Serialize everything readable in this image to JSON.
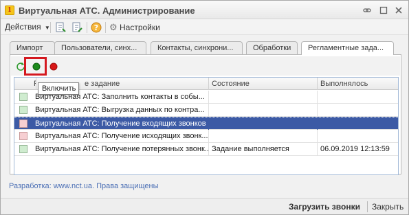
{
  "window": {
    "title": "Виртуальная АТС. Администрирование"
  },
  "toolbar": {
    "actions_label": "Действия",
    "settings_label": "Настройки"
  },
  "tabs": [
    {
      "label": "Импорт"
    },
    {
      "label": "Пользователи, синх..."
    },
    {
      "label": "Контакты, синхрони..."
    },
    {
      "label": "Обработки"
    },
    {
      "label": "Регламентные зада..."
    }
  ],
  "active_tab": "Регламентные зада...",
  "tooltip": {
    "text": "Включить"
  },
  "grid": {
    "columns": [
      "Р",
      "е задание",
      "Состояние",
      "Выполнялось"
    ],
    "rows": [
      {
        "flag": "green",
        "task": "Виртуальная АТС: Заполнить контакты в собы...",
        "state": "",
        "executed": ""
      },
      {
        "flag": "green",
        "task": "Виртуальная АТС: Выгрузка данных по контра...",
        "state": "",
        "executed": ""
      },
      {
        "flag": "red",
        "task": "Виртуальная АТС: Получение входящих звонков",
        "state": "",
        "executed": ""
      },
      {
        "flag": "red",
        "task": "Виртуальная АТС: Получение исходящих звонк...",
        "state": "",
        "executed": ""
      },
      {
        "flag": "green",
        "task": "Виртуальная АТС: Получение потерянных звонк...",
        "state": "Задание выполняется",
        "executed": "06.09.2019 12:13:59"
      }
    ],
    "selected_row": 2
  },
  "footer": {
    "developer_text": "Разработка: www.nct.ua. Права защищены"
  },
  "bottom_bar": {
    "load_calls_label": "Загрузить звонки",
    "close_label": "Закрыть"
  },
  "colors": {
    "selection": "#3c5aa5",
    "highlight": "#d4181f",
    "link": "#4b6fb5"
  }
}
